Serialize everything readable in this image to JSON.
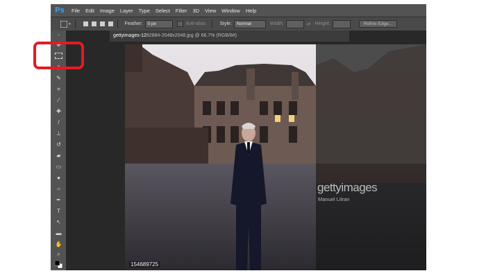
{
  "app": {
    "logo": "Ps"
  },
  "menubar": {
    "items": [
      "File",
      "Edit",
      "Image",
      "Layer",
      "Type",
      "Select",
      "Filter",
      "3D",
      "View",
      "Window",
      "Help"
    ]
  },
  "options": {
    "feather_label": "Feather:",
    "feather_value": "0 px",
    "antialias_label": "Anti-alias",
    "style_label": "Style:",
    "style_value": "Normal",
    "width_label": "Width:",
    "height_label": "Height:",
    "refine_edge_label": "Refine Edge..."
  },
  "document": {
    "tab_active": "gettyimages-12",
    "tab_rest": "82884-2048x2048.jpg @ 66.7% (RGB/8#)"
  },
  "image": {
    "watermark_brand": "gettyimages",
    "watermark_credit": "Manuel Litran",
    "image_id": "154689725"
  },
  "tools": [
    "move-icon",
    "marquee-icon",
    "lasso-icon",
    "quick-select-icon",
    "crop-icon",
    "eyedropper-icon",
    "healing-brush-icon",
    "brush-icon",
    "clone-stamp-icon",
    "history-brush-icon",
    "eraser-icon",
    "gradient-icon",
    "blur-icon",
    "dodge-icon",
    "pen-icon",
    "type-icon",
    "path-select-icon",
    "shape-icon",
    "hand-icon",
    "zoom-icon",
    "color-swatches-icon"
  ],
  "colors": {
    "highlight": "#e51a24",
    "ps_blue": "#31a8ff"
  }
}
